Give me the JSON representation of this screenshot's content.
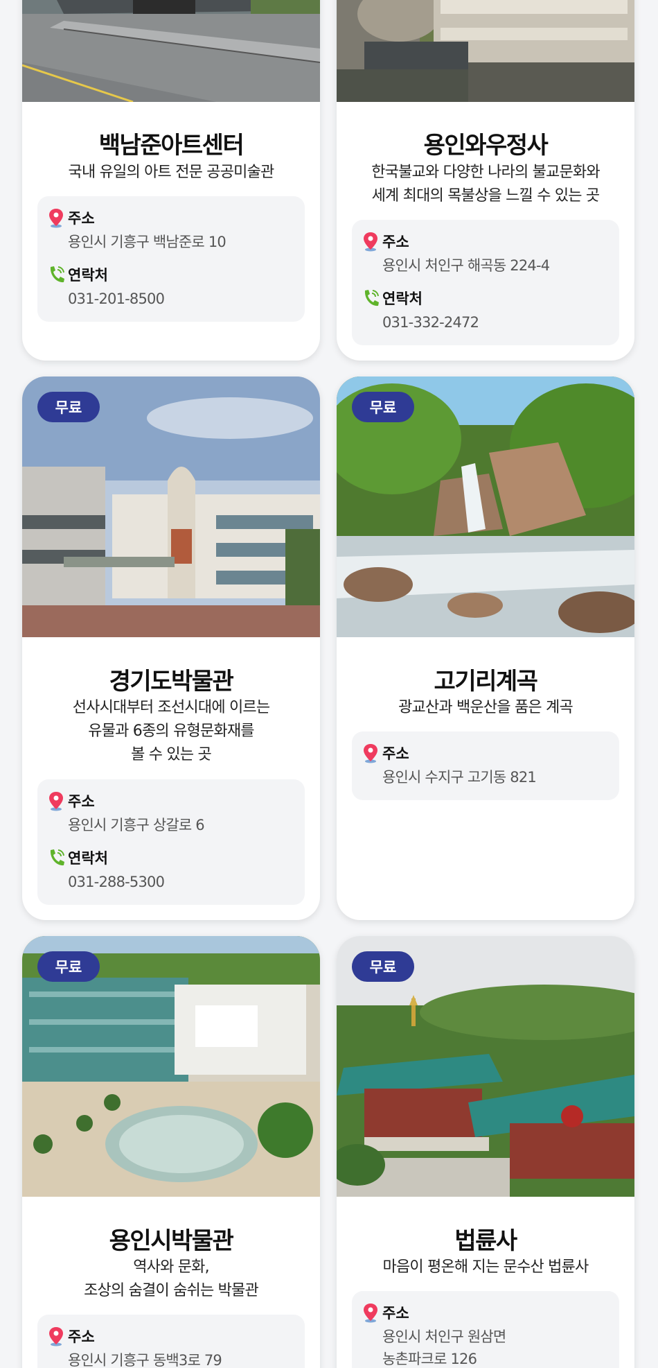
{
  "labels": {
    "address": "주소",
    "contact": "연락처"
  },
  "colors": {
    "badge": "#2f3b95",
    "pin": "#ef3b5e",
    "phone": "#5fb32b"
  },
  "cards": [
    {
      "title": "백남준아트센터",
      "description": [
        "국내 유일의 아트 전문 공공미술관"
      ],
      "address": [
        "용인시 기흥구 백남준로 10"
      ],
      "phone": "031-201-8500"
    },
    {
      "title": "용인와우정사",
      "description": [
        "한국불교와 다양한 나라의 불교문화와",
        "세계 최대의 목불상을 느낄 수 있는 곳"
      ],
      "address": [
        "용인시 처인구 해곡동 224-4"
      ],
      "phone": "031-332-2472"
    },
    {
      "badge": "무료",
      "title": "경기도박물관",
      "description": [
        "선사시대부터 조선시대에 이르는",
        "유물과 6종의 유형문화재를",
        "볼 수 있는 곳"
      ],
      "address": [
        "용인시 기흥구 상갈로 6"
      ],
      "phone": "031-288-5300"
    },
    {
      "badge": "무료",
      "title": "고기리계곡",
      "description": [
        "광교산과 백운산을 품은 계곡"
      ],
      "address": [
        "용인시 수지구 고기동 821"
      ]
    },
    {
      "badge": "무료",
      "title": "용인시박물관",
      "description": [
        "역사와 문화,",
        "조상의 숨결이 숨쉬는 박물관"
      ],
      "address": [
        "용인시 기흥구 동백3로 79"
      ]
    },
    {
      "badge": "무료",
      "title": "법륜사",
      "description": [
        "마음이 평온해 지는 문수산 법륜사"
      ],
      "address": [
        "용인시 처인구 원삼면",
        "농촌파크로 126"
      ]
    }
  ]
}
